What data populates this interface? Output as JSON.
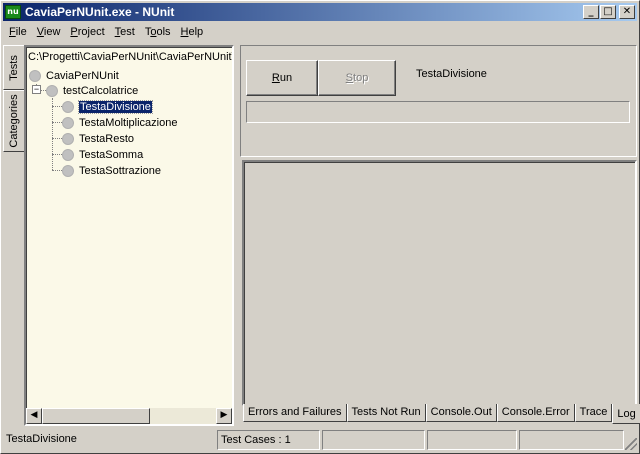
{
  "window": {
    "title": "CaviaPerNUnit.exe - NUnit",
    "icon_label": "nu",
    "controls": {
      "minimize": "_",
      "maximize": "□",
      "close": "✕"
    }
  },
  "menubar": {
    "items": [
      {
        "label": "File",
        "mnemonic": "F",
        "rest": "ile"
      },
      {
        "label": "View",
        "mnemonic": "V",
        "rest": "iew"
      },
      {
        "label": "Project",
        "mnemonic": "P",
        "rest": "roject"
      },
      {
        "label": "Test",
        "mnemonic": "T",
        "rest": "est"
      },
      {
        "label": "Tools",
        "pre": "T",
        "mnemonic": "o",
        "rest": "ols"
      },
      {
        "label": "Help",
        "mnemonic": "H",
        "rest": "elp"
      }
    ]
  },
  "side_tabs": {
    "tests": "Tests",
    "categories": "Categories"
  },
  "tree": {
    "path": "C:\\Progetti\\CaviaPerNUnit\\CaviaPerNUnit\\Cavia",
    "root": "CaviaPerNUnit",
    "fixture": "testCalcolatrice",
    "fixture_expander": "−",
    "tests": [
      "TestaDivisione",
      "TestaMoltiplicazione",
      "TestaResto",
      "TestaSomma",
      "TestaSottrazione"
    ],
    "selected": "TestaDivisione"
  },
  "run_panel": {
    "run_label": {
      "mnemonic": "R",
      "rest": "un"
    },
    "stop_label": {
      "mnemonic": "S",
      "rest": "top"
    },
    "current_test": "TestaDivisione"
  },
  "output_tabs": [
    "Errors and Failures",
    "Tests Not Run",
    "Console.Out",
    "Console.Error",
    "Trace",
    "Log"
  ],
  "active_output_tab": "Log",
  "statusbar": {
    "status": "TestaDivisione",
    "test_cases": "Test Cases : 1"
  },
  "scrollbar": {
    "left_arrow": "◀",
    "right_arrow": "▶"
  }
}
